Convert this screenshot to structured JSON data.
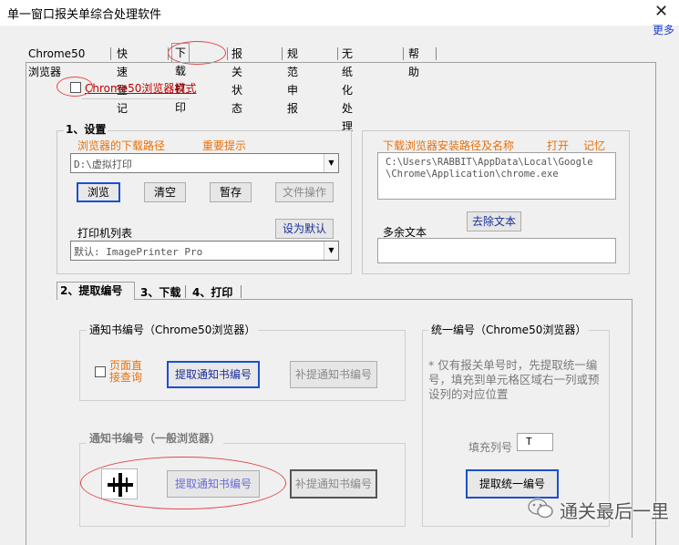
{
  "window": {
    "title": "单一窗口报关单综合处理软件",
    "more_link": "更多"
  },
  "main_tabs": [
    {
      "label": "Chrome50浏览器"
    },
    {
      "label": "快速登记"
    },
    {
      "label": "下载打印"
    },
    {
      "label": "报关状态"
    },
    {
      "label": "规范申报"
    },
    {
      "label": "无纸化处理"
    },
    {
      "label": "帮助"
    }
  ],
  "chrome_mode": {
    "label": "Chrome50浏览器模式",
    "checked": false
  },
  "settings": {
    "title": "1、设置",
    "download_path_label": "浏览器的下载路径",
    "important_tip": "重要提示",
    "download_path_value": "D:\\虚拟打印",
    "browse_btn": "浏览",
    "clear_btn": "清空",
    "pause_btn": "暂存",
    "file_ops_btn": "文件操作",
    "printer_list_label": "打印机列表",
    "set_default_btn": "设为默认",
    "printer_value": "默认: ImagePrinter Pro"
  },
  "browser_path": {
    "label": "下载浏览器安装路径及名称",
    "open_link": "打开",
    "remember_link": "记忆",
    "path_line1": "C:\\Users\\RABBIT\\AppData\\Local\\Google",
    "path_line2": "\\Chrome\\Application\\chrome.exe",
    "remove_text_btn": "去除文本",
    "extra_text_label": "多余文本"
  },
  "sub_tabs": [
    {
      "label": "2、提取编号"
    },
    {
      "label": "3、下载"
    },
    {
      "label": "4、打印"
    }
  ],
  "notice_chrome": {
    "title": "通知书编号（Chrome50浏览器）",
    "page_direct_line1": "页面直",
    "page_direct_line2": "接查询",
    "extract_btn": "提取通知书编号",
    "supplement_btn": "补提通知书编号"
  },
  "notice_general": {
    "title": "通知书编号（一般浏览器）",
    "extract_btn": "提取通知书编号",
    "supplement_btn": "补提通知书编号"
  },
  "unified": {
    "title": "统一编号（Chrome50浏览器）",
    "note": "* 仅有报关单号时，先提取统一编号，填充到单元格区域右一列或预设列的对应位置",
    "fill_col_label": "填充列号",
    "fill_col_value": "T",
    "extract_btn": "提取统一编号"
  },
  "watermark": {
    "text": "通关最后一里"
  }
}
